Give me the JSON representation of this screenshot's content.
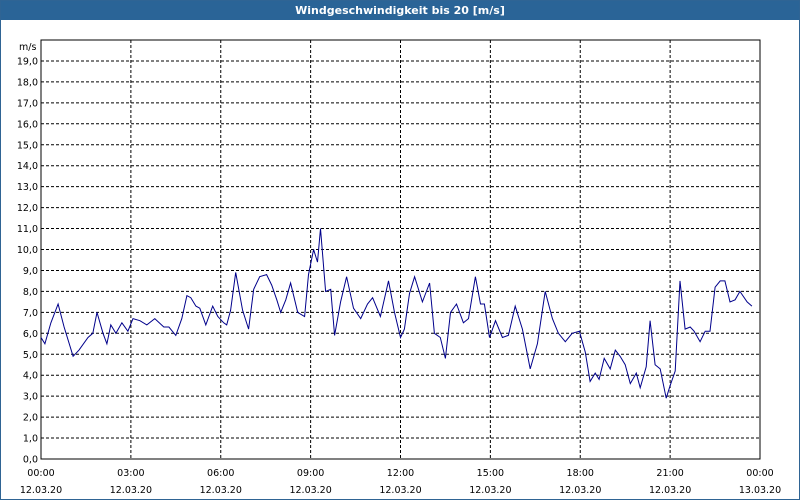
{
  "window": {
    "title": "Windgeschwindigkeit bis 20 [m/s]"
  },
  "chart_data": {
    "type": "line",
    "title": "Windgeschwindigkeit bis 20 [m/s]",
    "ylabel": "m/s",
    "ylim": [
      0,
      20
    ],
    "yticks": [
      "0,0",
      "1,0",
      "2,0",
      "3,0",
      "4,0",
      "5,0",
      "6,0",
      "7,0",
      "8,0",
      "9,0",
      "10,0",
      "11,0",
      "12,0",
      "13,0",
      "14,0",
      "15,0",
      "16,0",
      "17,0",
      "18,0",
      "19,0"
    ],
    "xlim_hours": [
      0,
      24
    ],
    "xticks": [
      {
        "time": "00:00",
        "date": "12.03.20"
      },
      {
        "time": "03:00",
        "date": "12.03.20"
      },
      {
        "time": "06:00",
        "date": "12.03.20"
      },
      {
        "time": "09:00",
        "date": "12.03.20"
      },
      {
        "time": "12:00",
        "date": "12.03.20"
      },
      {
        "time": "15:00",
        "date": "12.03.20"
      },
      {
        "time": "18:00",
        "date": "12.03.20"
      },
      {
        "time": "21:00",
        "date": "12.03.20"
      },
      {
        "time": "00:00",
        "date": "13.03.20"
      }
    ],
    "grid": true,
    "line_color": "#00008b",
    "series": [
      {
        "x_hours": [
          0.0,
          0.13,
          0.33,
          0.57,
          0.77,
          1.07,
          1.27,
          1.57,
          1.73,
          1.87,
          2.07,
          2.2,
          2.33,
          2.5,
          2.7,
          2.9,
          3.07,
          3.3,
          3.53,
          3.8,
          4.1,
          4.27,
          4.5,
          4.7,
          4.87,
          5.0,
          5.17,
          5.3,
          5.5,
          5.73,
          5.9,
          6.1,
          6.2,
          6.33,
          6.5,
          6.73,
          6.93,
          7.1,
          7.3,
          7.53,
          7.7,
          7.87,
          8.0,
          8.17,
          8.33,
          8.57,
          8.8,
          8.93,
          9.1,
          9.23,
          9.33,
          9.5,
          9.67,
          9.8,
          10.0,
          10.2,
          10.43,
          10.67,
          10.9,
          11.07,
          11.33,
          11.6,
          11.8,
          12.0,
          12.13,
          12.3,
          12.47,
          12.73,
          12.97,
          13.13,
          13.33,
          13.5,
          13.67,
          13.87,
          14.1,
          14.27,
          14.5,
          14.67,
          14.8,
          14.97,
          15.17,
          15.4,
          15.6,
          15.83,
          16.07,
          16.33,
          16.57,
          16.83,
          17.07,
          17.27,
          17.5,
          17.73,
          17.97,
          18.17,
          18.33,
          18.5,
          18.63,
          18.8,
          19.0,
          19.17,
          19.33,
          19.5,
          19.67,
          19.87,
          20.0,
          20.2,
          20.33,
          20.5,
          20.67,
          20.87,
          21.0,
          21.17,
          21.33,
          21.5,
          21.67,
          21.8,
          22.0,
          22.17,
          22.33,
          22.5,
          22.67,
          22.83,
          23.0,
          23.17,
          23.33,
          23.57,
          23.73,
          23.9,
          24.0
        ],
        "values": [
          5.8,
          5.5,
          6.5,
          7.4,
          6.3,
          4.9,
          5.2,
          5.8,
          6.0,
          7.0,
          6.0,
          5.5,
          6.4,
          6.0,
          6.5,
          6.1,
          6.7,
          6.6,
          6.4,
          6.7,
          6.3,
          6.3,
          5.9,
          6.7,
          7.8,
          7.7,
          7.3,
          7.2,
          6.4,
          7.3,
          6.8,
          6.5,
          6.4,
          7.1,
          8.9,
          7.1,
          6.2,
          8.1,
          8.7,
          8.8,
          8.3,
          7.6,
          7.0,
          7.6,
          8.4,
          7.0,
          6.8,
          8.8,
          10.0,
          9.4,
          11.0,
          8.0,
          8.1,
          5.9,
          7.5,
          8.7,
          7.2,
          6.7,
          7.4,
          7.7,
          6.8,
          8.5,
          7.0,
          5.8,
          6.2,
          7.9,
          8.7,
          7.5,
          8.4,
          6.0,
          5.8,
          4.8,
          7.0,
          7.4,
          6.5,
          6.7,
          8.7,
          7.4,
          7.4,
          5.8,
          6.6,
          5.8,
          5.9,
          7.3,
          6.2,
          4.3,
          5.5,
          8.0,
          6.7,
          6.0,
          5.6,
          6.0,
          6.1,
          5.1,
          3.7,
          4.1,
          3.8,
          4.8,
          4.3,
          5.2,
          4.9,
          4.5,
          3.6,
          4.1,
          3.4,
          4.4,
          6.6,
          4.5,
          4.3,
          2.9,
          3.5,
          4.2,
          8.5,
          6.2,
          6.3,
          6.1,
          5.6,
          6.1,
          6.1,
          8.2,
          8.5,
          8.5,
          7.5,
          7.6,
          8.0,
          7.5,
          7.3
        ]
      }
    ]
  }
}
